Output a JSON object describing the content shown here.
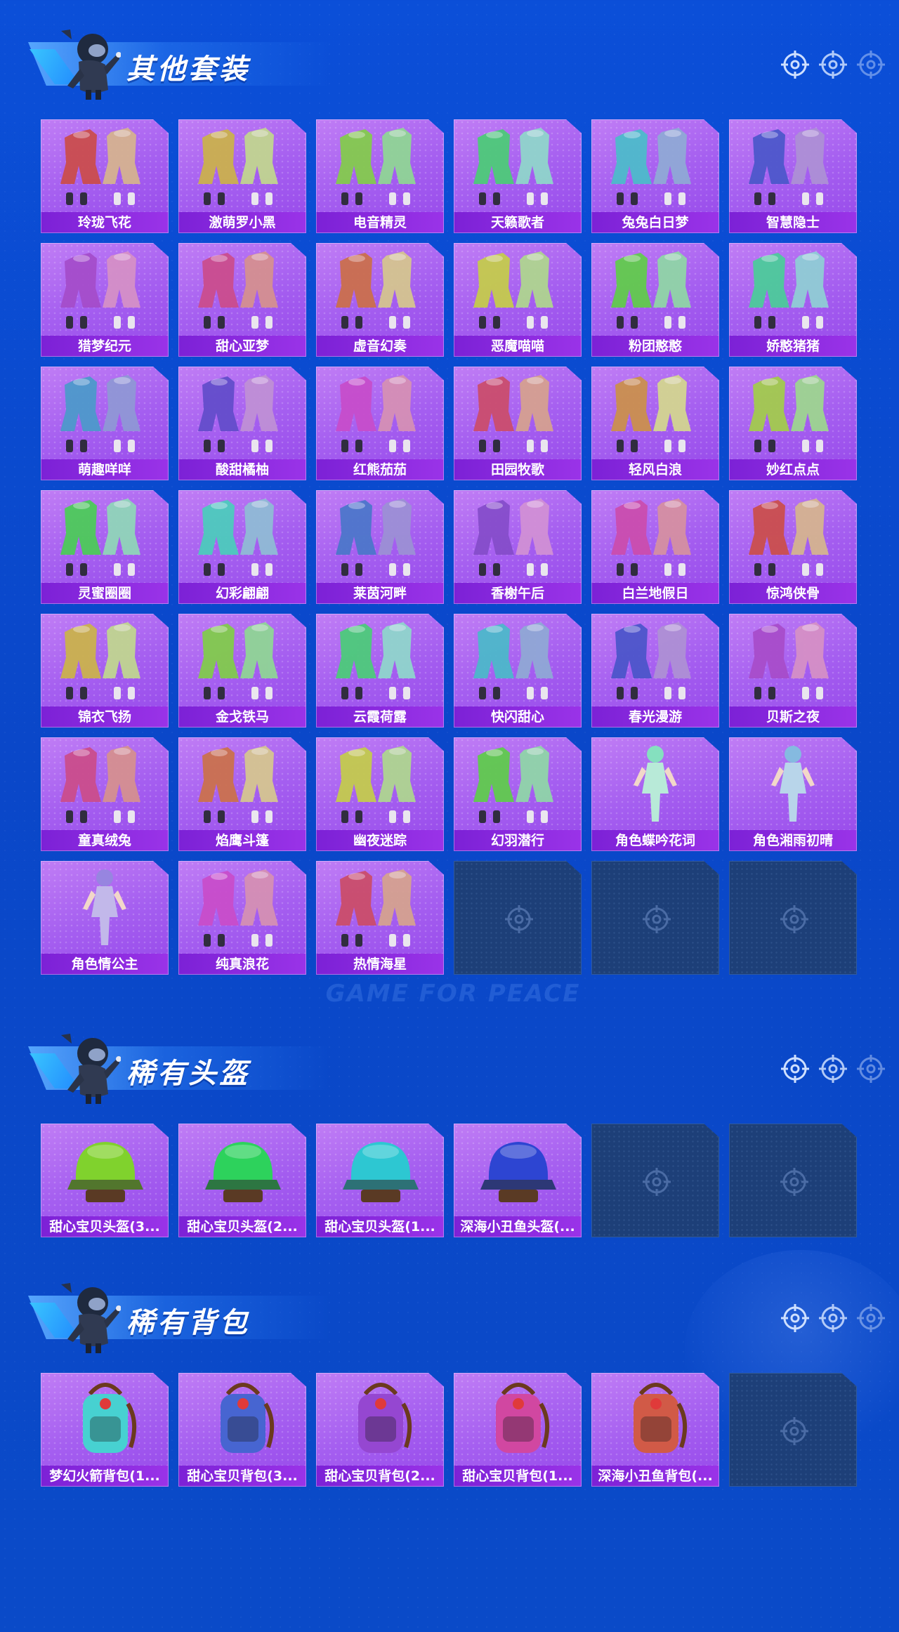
{
  "colors": {
    "background": "#0b4fd8",
    "card_purple": "#a55ff0",
    "label_bar": "#7c21d6",
    "empty_slot": "#1d3f78"
  },
  "watermark": "GAME FOR PEACE",
  "sections": [
    {
      "title": "其他套装",
      "items": [
        {
          "label": "玲珑飞花",
          "icon": "outfit-icon"
        },
        {
          "label": "激萌罗小黑",
          "icon": "outfit-icon"
        },
        {
          "label": "电音精灵",
          "icon": "outfit-icon"
        },
        {
          "label": "天籁歌者",
          "icon": "outfit-icon"
        },
        {
          "label": "兔兔白日梦",
          "icon": "outfit-icon"
        },
        {
          "label": "智慧隐士",
          "icon": "outfit-icon"
        },
        {
          "label": "猎梦纪元",
          "icon": "outfit-icon"
        },
        {
          "label": "甜心亚梦",
          "icon": "outfit-icon"
        },
        {
          "label": "虚音幻奏",
          "icon": "outfit-icon"
        },
        {
          "label": "恶魔喵喵",
          "icon": "outfit-icon"
        },
        {
          "label": "粉团憨憨",
          "icon": "outfit-icon"
        },
        {
          "label": "娇憨猪猪",
          "icon": "outfit-icon"
        },
        {
          "label": "萌趣咩咩",
          "icon": "outfit-icon"
        },
        {
          "label": "酸甜橘柚",
          "icon": "outfit-icon"
        },
        {
          "label": "红熊茄茄",
          "icon": "outfit-icon"
        },
        {
          "label": "田园牧歌",
          "icon": "outfit-icon"
        },
        {
          "label": "轻风白浪",
          "icon": "outfit-icon"
        },
        {
          "label": "妙红点点",
          "icon": "outfit-icon"
        },
        {
          "label": "灵蜜圈圈",
          "icon": "outfit-icon"
        },
        {
          "label": "幻彩翩翩",
          "icon": "outfit-icon"
        },
        {
          "label": "莱茵河畔",
          "icon": "outfit-icon"
        },
        {
          "label": "香榭午后",
          "icon": "outfit-icon"
        },
        {
          "label": "白兰地假日",
          "icon": "outfit-icon"
        },
        {
          "label": "惊鸿侠骨",
          "icon": "outfit-icon"
        },
        {
          "label": "锦衣飞扬",
          "icon": "outfit-icon"
        },
        {
          "label": "金戈铁马",
          "icon": "outfit-icon"
        },
        {
          "label": "云霞荷露",
          "icon": "outfit-icon"
        },
        {
          "label": "快闪甜心",
          "icon": "outfit-icon"
        },
        {
          "label": "春光漫游",
          "icon": "outfit-icon"
        },
        {
          "label": "贝斯之夜",
          "icon": "outfit-icon"
        },
        {
          "label": "童真绒兔",
          "icon": "outfit-icon"
        },
        {
          "label": "焰鹰斗篷",
          "icon": "outfit-icon"
        },
        {
          "label": "幽夜迷踪",
          "icon": "outfit-icon"
        },
        {
          "label": "幻羽潜行",
          "icon": "outfit-icon"
        },
        {
          "label": "角色蝶吟花词",
          "icon": "character-icon"
        },
        {
          "label": "角色湘雨初晴",
          "icon": "character-icon"
        },
        {
          "label": "角色情公主",
          "icon": "character-icon"
        },
        {
          "label": "纯真浪花",
          "icon": "outfit-icon"
        },
        {
          "label": "热情海星",
          "icon": "outfit-icon"
        }
      ],
      "empty_slots": 3
    },
    {
      "title": "稀有头盔",
      "items": [
        {
          "label": "甜心宝贝头盔(3...",
          "icon": "helmet-icon"
        },
        {
          "label": "甜心宝贝头盔(2...",
          "icon": "helmet-icon"
        },
        {
          "label": "甜心宝贝头盔(1...",
          "icon": "helmet-icon"
        },
        {
          "label": "深海小丑鱼头盔(...",
          "icon": "helmet-icon"
        }
      ],
      "empty_slots": 2
    },
    {
      "title": "稀有背包",
      "items": [
        {
          "label": "梦幻火箭背包(1...",
          "icon": "backpack-icon"
        },
        {
          "label": "甜心宝贝背包(3...",
          "icon": "backpack-icon"
        },
        {
          "label": "甜心宝贝背包(2...",
          "icon": "backpack-icon"
        },
        {
          "label": "甜心宝贝背包(1...",
          "icon": "backpack-icon"
        },
        {
          "label": "深海小丑鱼背包(...",
          "icon": "backpack-icon"
        }
      ],
      "empty_slots": 1
    }
  ]
}
